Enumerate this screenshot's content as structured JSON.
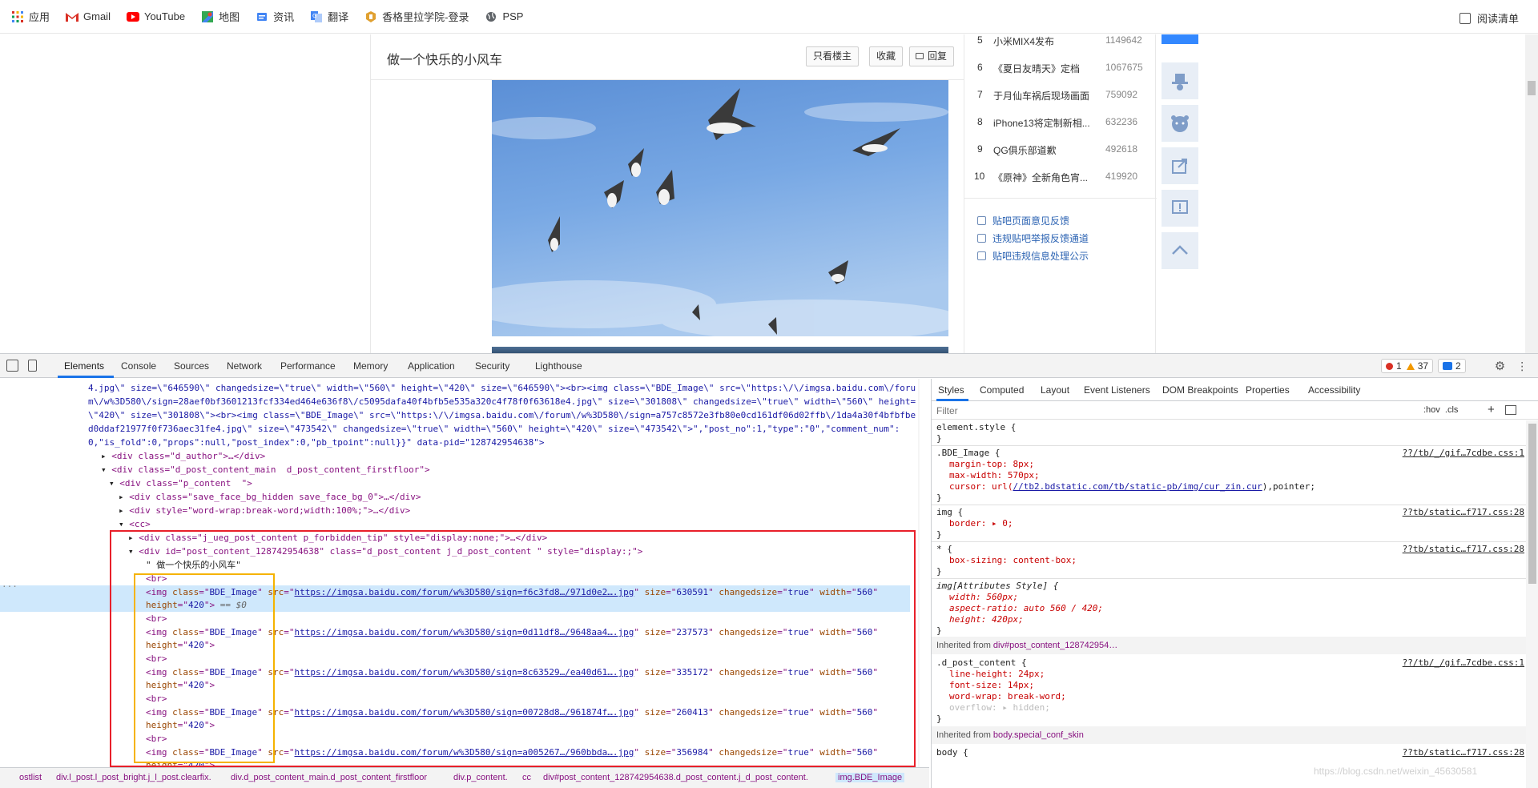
{
  "bookmarks": {
    "items": [
      {
        "label": "应用",
        "icon": "apps-grid-icon"
      },
      {
        "label": "Gmail",
        "icon": "gmail-icon"
      },
      {
        "label": "YouTube",
        "icon": "youtube-icon"
      },
      {
        "label": "地图",
        "icon": "maps-icon"
      },
      {
        "label": "资讯",
        "icon": "news-icon"
      },
      {
        "label": "翻译",
        "icon": "translate-icon"
      },
      {
        "label": "香格里拉学院-登录",
        "icon": "academy-icon"
      },
      {
        "label": "PSP",
        "icon": "globe-icon"
      }
    ],
    "reading_list": "阅读清单"
  },
  "post": {
    "title": "做一个快乐的小风车",
    "buttons": {
      "only_op": "只看楼主",
      "favorite": "收藏",
      "reply": "回复"
    }
  },
  "rank": {
    "items": [
      {
        "n": "5",
        "title": "小米MIX4发布",
        "value": "1149642"
      },
      {
        "n": "6",
        "title": "《夏日友晴天》定档",
        "value": "1067675"
      },
      {
        "n": "7",
        "title": "于月仙车祸后现场画面",
        "value": "759092"
      },
      {
        "n": "8",
        "title": "iPhone13将定制新相...",
        "value": "632236"
      },
      {
        "n": "9",
        "title": "QG俱乐部道歉",
        "value": "492618"
      },
      {
        "n": "10",
        "title": "《原神》全新角色宵...",
        "value": "419920"
      }
    ],
    "links": [
      "贴吧页面意见反馈",
      "违规贴吧举报反馈通道",
      "贴吧违规信息处理公示"
    ]
  },
  "devtools": {
    "tabs": [
      "Elements",
      "Console",
      "Sources",
      "Network",
      "Performance",
      "Memory",
      "Application",
      "Security",
      "Lighthouse"
    ],
    "errors": "1",
    "warnings": "37",
    "messages": "2",
    "styles_tabs": [
      "Styles",
      "Computed",
      "Layout",
      "Event Listeners",
      "DOM Breakpoints",
      "Properties",
      "Accessibility"
    ],
    "filter_placeholder": "Filter",
    "filter_tools": ":hov  .cls",
    "dom_lines": {
      "l1": "4.jpg\\\" size=\\\"646590\\\" changedsize=\\\"true\\\" width=\\\"560\\\" height=\\\"420\\\" size=\\\"646590\\\"><br><img class=\\\"BDE_Image\\\" src=\\\"https:\\/\\/imgsa.baidu.com\\/foru",
      "l2": "m\\/w%3D580\\/sign=28aef0bf3601213fcf334ed464e636f8\\/c5095dafa40f4bfb5e535a320c4f78f0f63618e4.jpg\\\" size=\\\"301808\\\" changedsize=\\\"true\\\" width=\\\"560\\\" height=",
      "l3": "\\\"420\\\" size=\\\"301808\\\"><br><img class=\\\"BDE_Image\\\" src=\\\"https:\\/\\/imgsa.baidu.com\\/forum\\/w%3D580\\/sign=a757c8572e3fb80e0cd161df06d02ffb\\/1da4a30f4bfbfbe",
      "l4": "d0ddaf21977f0f736aec31fe4.jpg\\\" size=\\\"473542\\\" changedsize=\\\"true\\\" width=\\\"560\\\" height=\\\"420\\\" size=\\\"473542\\\">\",\"post_no\":1,\"type\":\"0\",\"comment_num\":",
      "l5": "0,\"is_fold\":0,\"props\":null,\"post_index\":0,\"pb_tpoint\":null}}\" data-pid=\"128742954638\">",
      "d_author": "<div class=\"d_author\">…</div>",
      "d_main": "<div class=\"d_post_content_main  d_post_content_firstfloor\">",
      "p_content": "<div class=\"p_content  \">",
      "save_face": "<div class=\"save_face_bg_hidden save_face_bg_0\">…</div>",
      "word_wrap": "<div style=\"word-wrap:break-word;width:100%;\">…</div>",
      "cc": "<cc>",
      "hidden_tip": "<div class=\"j_ueg_post_content p_forbidden_tip\" style=\"display:none;\">…</div>",
      "post_div": "<div id=\"post_content_128742954638\" class=\"d_post_content j_d_post_content \" style=\"display:;\">",
      "text_node": "\" 做一个快乐的小风车\"",
      "br": "<br>",
      "selected_suffix": " == $0",
      "img_rows": [
        {
          "sign": "https://imgsa.baidu.com/forum/w%3D580/sign=f6c3fd8…/971d0e2….jpg",
          "size": "630591"
        },
        {
          "sign": "https://imgsa.baidu.com/forum/w%3D580/sign=0d11df8…/9648aa4….jpg",
          "size": "237573"
        },
        {
          "sign": "https://imgsa.baidu.com/forum/w%3D580/sign=8c63529…/ea40d61….jpg",
          "size": "335172"
        },
        {
          "sign": "https://imgsa.baidu.com/forum/w%3D580/sign=00728d8…/961874f….jpg",
          "size": "260413"
        },
        {
          "sign": "https://imgsa.baidu.com/forum/w%3D580/sign=a005267…/960bbda….jpg",
          "size": "356984"
        }
      ]
    },
    "breadcrumbs": [
      "ostlist",
      "div.l_post.l_post_bright.j_l_post.clearfix.",
      "div.d_post_content_main.d_post_content_firstfloor",
      "div.p_content.",
      "cc",
      "div#post_content_128742954638.d_post_content.j_d_post_content.",
      "img.BDE_Image"
    ],
    "styles": {
      "element_style": "element.style {",
      "bde_selector": ".BDE_Image {",
      "bde_src": "??/tb/_/gif…7cdbe.css:1",
      "margin_top": "margin-top: 8px;",
      "max_width": "max-width: 570px;",
      "cursor_pre": "cursor: url(",
      "cursor_link": "//tb2.bdstatic.com/tb/static-pb/img/cur_zin.cur",
      "cursor_post": "),pointer;",
      "img_selector": "img {",
      "img_src": "??tb/static…f717.css:28",
      "border": "border: ▸ 0;",
      "star_selector": "* {",
      "star_src": "??tb/static…f717.css:28",
      "box_sizing": "box-sizing: content-box;",
      "attr_selector": "img[Attributes Style] {",
      "attr_width": "width: 560px;",
      "attr_aspect": "aspect-ratio: auto 560 / 420;",
      "attr_height": "height: 420px;",
      "inherited1_pre": "Inherited from ",
      "inherited1_tag": "div#post_content_128742954…",
      "dpc_selector": ".d_post_content {",
      "dpc_src": "??/tb/_/gif…7cdbe.css:1",
      "line_height": "line-height: 24px;",
      "font_size": "font-size: 14px;",
      "word_wrap": "word-wrap: break-word;",
      "overflow": "overflow: ▸ hidden;",
      "inherited2_pre": "Inherited from ",
      "inherited2_tag": "body.special_conf_skin",
      "body_selector": "body {",
      "body_src": "??tb/static…f717.css:28",
      "close_brace": "}"
    }
  },
  "watermark": "https://blog.csdn.net/weixin_45630581"
}
